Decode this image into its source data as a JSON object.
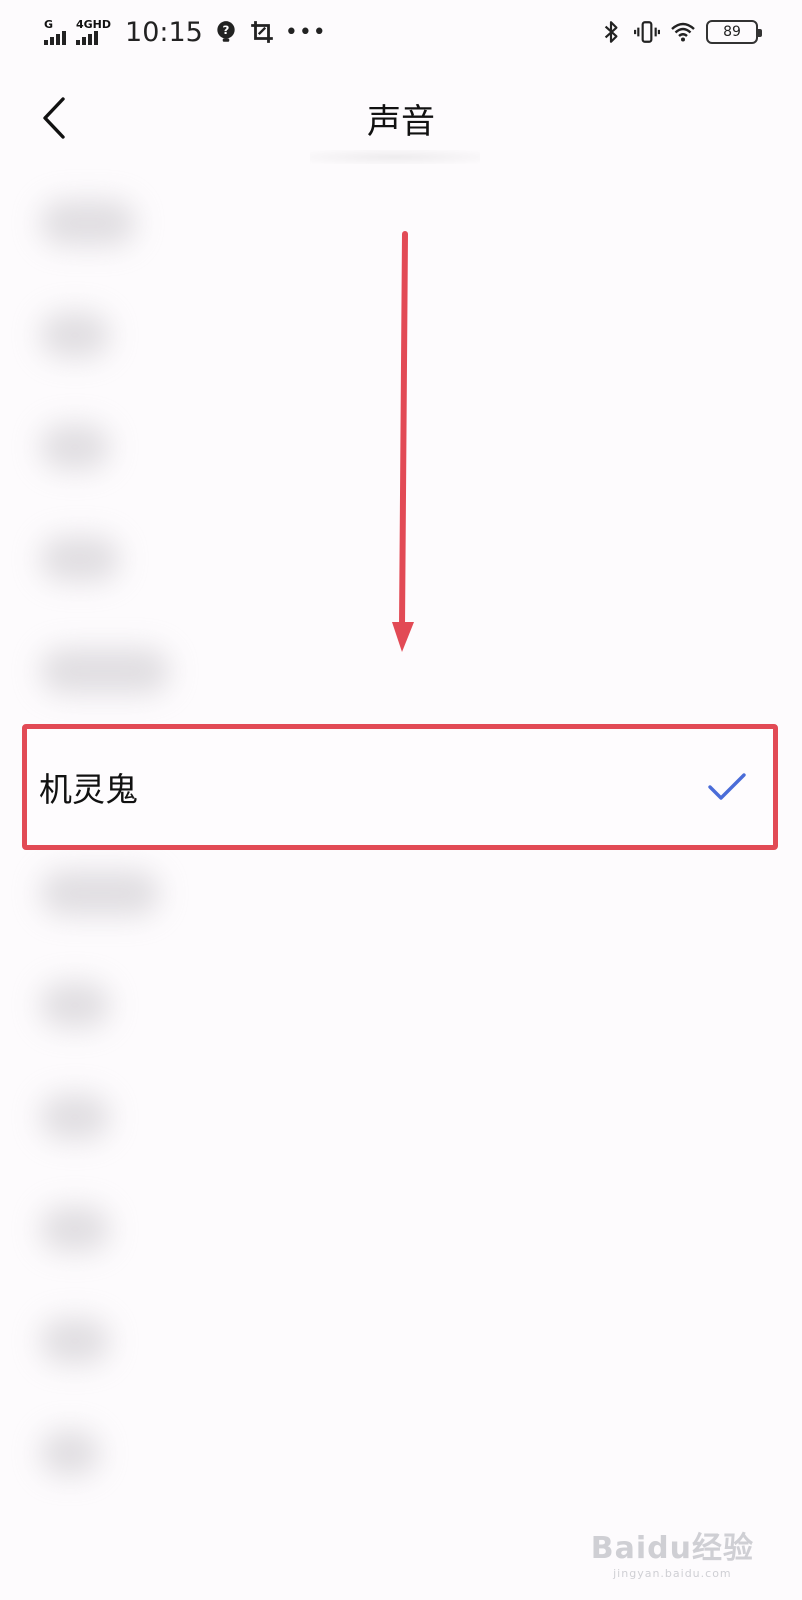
{
  "status_bar": {
    "signal1_label": "G",
    "signal2_label": "4GHD",
    "time": "10:15",
    "battery": "89"
  },
  "header": {
    "title": "声音"
  },
  "selected_item": {
    "label": "机灵鬼",
    "selected": true
  },
  "colors": {
    "highlight_border": "#e24a55",
    "arrow": "#e24a55",
    "check": "#4a6cd8"
  },
  "icons": [
    "back-arrow-icon",
    "check-icon",
    "bluetooth-icon",
    "vibrate-icon",
    "wifi-icon",
    "notification-icon",
    "screenshot-icon",
    "battery-icon"
  ],
  "watermark": {
    "main": "Baidu经验",
    "sub": "jingyan.baidu.com"
  }
}
